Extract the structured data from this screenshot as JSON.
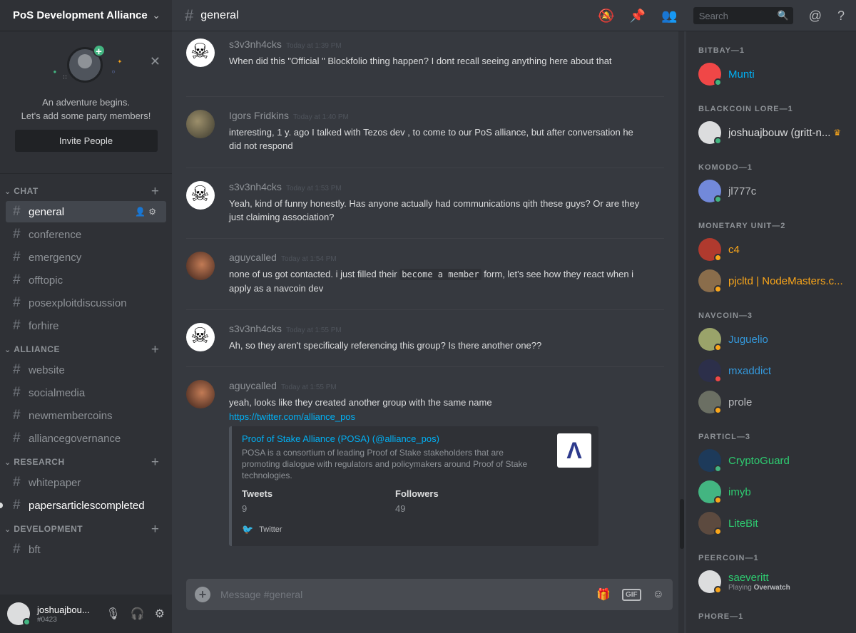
{
  "server": {
    "name": "PoS Development Alliance"
  },
  "invite": {
    "line1": "An adventure begins.",
    "line2": "Let's add some party members!",
    "button": "Invite People"
  },
  "categories": [
    {
      "label": "CHAT",
      "channels": [
        "general",
        "conference",
        "emergency",
        "offtopic",
        "posexploitdiscussion",
        "forhire"
      ]
    },
    {
      "label": "ALLIANCE",
      "channels": [
        "website",
        "socialmedia",
        "newmembercoins",
        "alliancegovernance"
      ]
    },
    {
      "label": "RESEARCH",
      "channels": [
        "whitepaper",
        "papersarticlescompleted"
      ]
    },
    {
      "label": "DEVELOPMENT",
      "channels": [
        "bft"
      ]
    }
  ],
  "user": {
    "name": "joshuajbou...",
    "tag": "#0423"
  },
  "header": {
    "channel": "general",
    "search_placeholder": "Search"
  },
  "messages": [
    {
      "author": "s3v3nh4cks",
      "time": "Today at 1:39 PM",
      "text": "When did this \"Official \" Blockfolio thing happen? I dont recall seeing anything here about that"
    },
    {
      "author": "Igors Fridkins",
      "time": "Today at 1:40 PM",
      "text": "interesting, 1 y. ago I talked with Tezos dev , to come to our PoS alliance, but after conversation he did not respond"
    },
    {
      "author": "s3v3nh4cks",
      "time": "Today at 1:53 PM",
      "text": "Yeah, kind of funny honestly. Has anyone actually had communications qith these guys? Or are they just claiming association?"
    },
    {
      "author": "aguycalled",
      "time": "Today at 1:54 PM",
      "text_a": "none of us got contacted. i just filled their ",
      "code": "become a member",
      "text_b": " form, let's see how they react when i apply as a navcoin dev"
    },
    {
      "author": "s3v3nh4cks",
      "time": "Today at 1:55 PM",
      "text": "Ah, so they aren't specifically referencing this group? Is there another one??"
    },
    {
      "author": "aguycalled",
      "time": "Today at 1:55 PM",
      "text": "yeah, looks like they created another group with the same name",
      "link": "https://twitter.com/alliance_pos"
    }
  ],
  "embed": {
    "title": "Proof of Stake Alliance (POSA) (@alliance_pos)",
    "description": "POSA is a consortium of leading Proof of Stake stakeholders that are promoting dialogue with regulators and policymakers around Proof of Stake technologies.",
    "field1_name": "Tweets",
    "field1_value": "9",
    "field2_name": "Followers",
    "field2_value": "49",
    "footer": "Twitter"
  },
  "composer": {
    "placeholder": "Message #general",
    "gif": "GIF"
  },
  "members": {
    "groups": [
      {
        "label": "BITBAY—1"
      },
      {
        "label": "BLACKCOIN LORE—1"
      },
      {
        "label": "KOMODO—1"
      },
      {
        "label": "MONETARY UNIT—2"
      },
      {
        "label": "NAVCOIN—3"
      },
      {
        "label": "PARTICL—3"
      },
      {
        "label": "PEERCOIN—1"
      },
      {
        "label": "PHORE—1"
      }
    ],
    "people": [
      {
        "name": "Munti",
        "color": "#00b0f4"
      },
      {
        "name": "joshuajbouw (gritt-n...",
        "color": "#dcddde"
      },
      {
        "name": "jl777c",
        "color": "#b9bbbe"
      },
      {
        "name": "c4",
        "color": "#faa61a"
      },
      {
        "name": "pjcltd | NodeMasters.c...",
        "color": "#faa61a"
      },
      {
        "name": "Juguelio",
        "color": "#3498db"
      },
      {
        "name": "mxaddict",
        "color": "#3498db"
      },
      {
        "name": "prole",
        "color": "#b9bbbe"
      },
      {
        "name": "CryptoGuard",
        "color": "#2ecc71"
      },
      {
        "name": "imyb",
        "color": "#2ecc71"
      },
      {
        "name": "LiteBit",
        "color": "#2ecc71"
      },
      {
        "name": "saeveritt",
        "color": "#2ecc71",
        "activity_prefix": "Playing",
        "activity_game": "Overwatch"
      }
    ]
  },
  "colors": {
    "online": "#43b581",
    "idle": "#faa61a",
    "dnd": "#f04747",
    "blurple": "#7289da"
  }
}
